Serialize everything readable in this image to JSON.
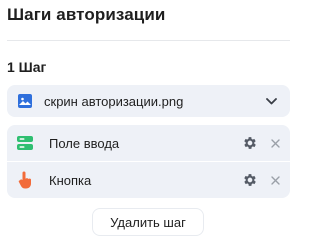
{
  "panel": {
    "title": "Шаги авторизации"
  },
  "step": {
    "label": "1 Шаг",
    "file": {
      "name": "скрин авторизации.png",
      "icon": "image-icon"
    },
    "elements": [
      {
        "label": "Поле ввода",
        "icon": "input-field-icon",
        "icon_color": "#2fbf71"
      },
      {
        "label": "Кнопка",
        "icon": "pointer-hand-icon",
        "icon_color": "#f26b3a"
      }
    ]
  },
  "actions": {
    "delete_label": "Удалить шаг"
  },
  "colors": {
    "accent": "#2f6fdc",
    "surface": "#eef1f7",
    "icon_gray": "#555b66"
  }
}
